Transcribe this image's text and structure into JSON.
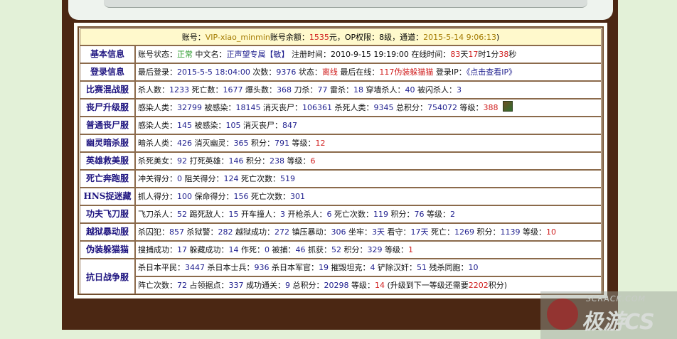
{
  "header": {
    "account_label": "账号：",
    "account_id": "VIP-xiao_minmin",
    "balance_label": "账号余额：",
    "balance_value": "1535",
    "balance_unit": "元，OP权限：",
    "op_level": "8",
    "op_unit": "级，通道：",
    "channel_time": "2015-5-14 9:06:13",
    "close_paren": ")"
  },
  "rows": [
    {
      "label": "基本信息",
      "parts": [
        {
          "t": "账号状态："
        },
        {
          "t": "正常",
          "c": "g"
        },
        {
          "t": " 中文名："
        },
        {
          "t": "正声望专属【敏】",
          "c": "n"
        },
        {
          "t": " 注册时间：2010-9-15 19:19:00 在线时间："
        },
        {
          "t": "83",
          "c": "r"
        },
        {
          "t": "天"
        },
        {
          "t": "17",
          "c": "r"
        },
        {
          "t": "时1分"
        },
        {
          "t": "38",
          "c": "r"
        },
        {
          "t": "秒"
        }
      ]
    },
    {
      "label": "登录信息",
      "parts": [
        {
          "t": "最后登录："
        },
        {
          "t": "2015-5-5 18:04:00",
          "c": "n"
        },
        {
          "t": " 次数："
        },
        {
          "t": "9376",
          "c": "n"
        },
        {
          "t": " 状态："
        },
        {
          "t": "离线",
          "c": "r"
        },
        {
          "t": " 最后在线："
        },
        {
          "t": "117伪装躲猫猫",
          "c": "r"
        },
        {
          "t": " 登录IP："
        },
        {
          "t": "《点击查看IP》",
          "c": "lnk",
          "link": true
        }
      ]
    },
    {
      "label": "比赛混战服",
      "parts": [
        {
          "t": "杀人数："
        },
        {
          "t": "1233",
          "c": "n"
        },
        {
          "t": " 死亡数："
        },
        {
          "t": "1677",
          "c": "n"
        },
        {
          "t": " 爆头数："
        },
        {
          "t": "368",
          "c": "n"
        },
        {
          "t": " 刀杀："
        },
        {
          "t": "77",
          "c": "n"
        },
        {
          "t": " 雷杀："
        },
        {
          "t": "18",
          "c": "n"
        },
        {
          "t": " 穿墙杀人："
        },
        {
          "t": "40",
          "c": "n"
        },
        {
          "t": " 被闪杀人："
        },
        {
          "t": "3",
          "c": "n"
        }
      ]
    },
    {
      "label": "丧尸升级服",
      "avatar": true,
      "parts": [
        {
          "t": "感染人类："
        },
        {
          "t": "32799",
          "c": "n"
        },
        {
          "t": " 被感染："
        },
        {
          "t": "18145",
          "c": "n"
        },
        {
          "t": " 消灭丧尸："
        },
        {
          "t": "106361",
          "c": "n"
        },
        {
          "t": " 杀死人类："
        },
        {
          "t": "9345",
          "c": "n"
        },
        {
          "t": " 总积分："
        },
        {
          "t": "754072",
          "c": "n"
        },
        {
          "t": " 等级："
        },
        {
          "t": "388",
          "c": "r"
        }
      ]
    },
    {
      "label": "普通丧尸服",
      "parts": [
        {
          "t": "感染人类："
        },
        {
          "t": "145",
          "c": "n"
        },
        {
          "t": " 被感染："
        },
        {
          "t": "105",
          "c": "n"
        },
        {
          "t": " 消灭丧尸："
        },
        {
          "t": "847",
          "c": "n"
        }
      ]
    },
    {
      "label": "幽灵暗杀服",
      "parts": [
        {
          "t": "暗杀人类："
        },
        {
          "t": "426",
          "c": "n"
        },
        {
          "t": " 消灭幽灵："
        },
        {
          "t": "365",
          "c": "n"
        },
        {
          "t": " 积分："
        },
        {
          "t": "791",
          "c": "n"
        },
        {
          "t": " 等级："
        },
        {
          "t": "12",
          "c": "r"
        }
      ]
    },
    {
      "label": "英雄救美服",
      "parts": [
        {
          "t": "杀死美女："
        },
        {
          "t": "92",
          "c": "n"
        },
        {
          "t": " 打死英雄："
        },
        {
          "t": "146",
          "c": "n"
        },
        {
          "t": " 积分："
        },
        {
          "t": "238",
          "c": "n"
        },
        {
          "t": " 等级："
        },
        {
          "t": "6",
          "c": "r"
        }
      ]
    },
    {
      "label": "死亡奔跑服",
      "parts": [
        {
          "t": "冲关得分："
        },
        {
          "t": "0",
          "c": "n"
        },
        {
          "t": " 阻关得分："
        },
        {
          "t": "124",
          "c": "n"
        },
        {
          "t": " 死亡次数："
        },
        {
          "t": "519",
          "c": "n"
        }
      ]
    },
    {
      "label": "HNS捉迷藏",
      "parts": [
        {
          "t": "抓人得分："
        },
        {
          "t": "100",
          "c": "n"
        },
        {
          "t": " 保命得分："
        },
        {
          "t": "156",
          "c": "n"
        },
        {
          "t": " 死亡次数："
        },
        {
          "t": "301",
          "c": "n"
        }
      ]
    },
    {
      "label": "功夫飞刀服",
      "parts": [
        {
          "t": "飞刀杀人："
        },
        {
          "t": "52",
          "c": "n"
        },
        {
          "t": " 踢死敌人："
        },
        {
          "t": "15",
          "c": "n"
        },
        {
          "t": " 开车撞人："
        },
        {
          "t": "3",
          "c": "n"
        },
        {
          "t": " 开枪杀人："
        },
        {
          "t": "6",
          "c": "n"
        },
        {
          "t": " 死亡次数："
        },
        {
          "t": "119",
          "c": "n"
        },
        {
          "t": " 积分："
        },
        {
          "t": "76",
          "c": "n"
        },
        {
          "t": " 等级："
        },
        {
          "t": "2",
          "c": "n"
        }
      ]
    },
    {
      "label": "越狱暴动服",
      "parts": [
        {
          "t": "杀囚犯："
        },
        {
          "t": "857",
          "c": "n"
        },
        {
          "t": " 杀狱警："
        },
        {
          "t": "282",
          "c": "n"
        },
        {
          "t": " 越狱成功："
        },
        {
          "t": "272",
          "c": "n"
        },
        {
          "t": " 镇压暴动："
        },
        {
          "t": "306",
          "c": "n"
        },
        {
          "t": " 坐牢："
        },
        {
          "t": "3天",
          "c": "n"
        },
        {
          "t": " 看守："
        },
        {
          "t": "17天",
          "c": "n"
        },
        {
          "t": " 死亡："
        },
        {
          "t": "1269",
          "c": "n"
        },
        {
          "t": " 积分："
        },
        {
          "t": "1139",
          "c": "n"
        },
        {
          "t": " 等级："
        },
        {
          "t": "10",
          "c": "r"
        }
      ]
    },
    {
      "label": "伪装躲猫猫",
      "parts": [
        {
          "t": "搜捕成功："
        },
        {
          "t": "17",
          "c": "n"
        },
        {
          "t": " 躲藏成功："
        },
        {
          "t": "14",
          "c": "n"
        },
        {
          "t": " 作死："
        },
        {
          "t": "0",
          "c": "n"
        },
        {
          "t": " 被捕："
        },
        {
          "t": "46",
          "c": "n"
        },
        {
          "t": " 抓获："
        },
        {
          "t": "52",
          "c": "n"
        },
        {
          "t": " 积分："
        },
        {
          "t": "329",
          "c": "n"
        },
        {
          "t": " 等级："
        },
        {
          "t": "1",
          "c": "r"
        }
      ]
    }
  ],
  "war_row": {
    "label": "抗日战争服",
    "line1": [
      {
        "t": "杀日本平民："
      },
      {
        "t": "3447",
        "c": "n"
      },
      {
        "t": " 杀日本士兵："
      },
      {
        "t": "936",
        "c": "n"
      },
      {
        "t": " 杀日本军官："
      },
      {
        "t": "19",
        "c": "n"
      },
      {
        "t": " 摧毁坦克："
      },
      {
        "t": "4",
        "c": "n"
      },
      {
        "t": " 铲除汉奸："
      },
      {
        "t": "51",
        "c": "n"
      },
      {
        "t": " 残杀同胞："
      },
      {
        "t": "10",
        "c": "n"
      }
    ],
    "line2": [
      {
        "t": "阵亡次数："
      },
      {
        "t": "72",
        "c": "n"
      },
      {
        "t": " 占领据点："
      },
      {
        "t": "337",
        "c": "n"
      },
      {
        "t": " 成功通关："
      },
      {
        "t": "9",
        "c": "n"
      },
      {
        "t": " 总积分："
      },
      {
        "t": "20298",
        "c": "n"
      },
      {
        "t": " 等级："
      },
      {
        "t": "14",
        "c": "r"
      },
      {
        "t": " (升级到下一等级还需要"
      },
      {
        "t": "2202",
        "c": "r"
      },
      {
        "t": "积分)"
      }
    ]
  },
  "watermark": {
    "small": "SCRACK.COM",
    "big": "极游CS"
  },
  "colors": {
    "frame_bg": "#4b2713",
    "page_bg": "#e3f1d8",
    "label_text": "#1f1580",
    "number_text": "#1f1f8e",
    "red_text": "#d02020",
    "status_green": "#2a9a2a"
  }
}
